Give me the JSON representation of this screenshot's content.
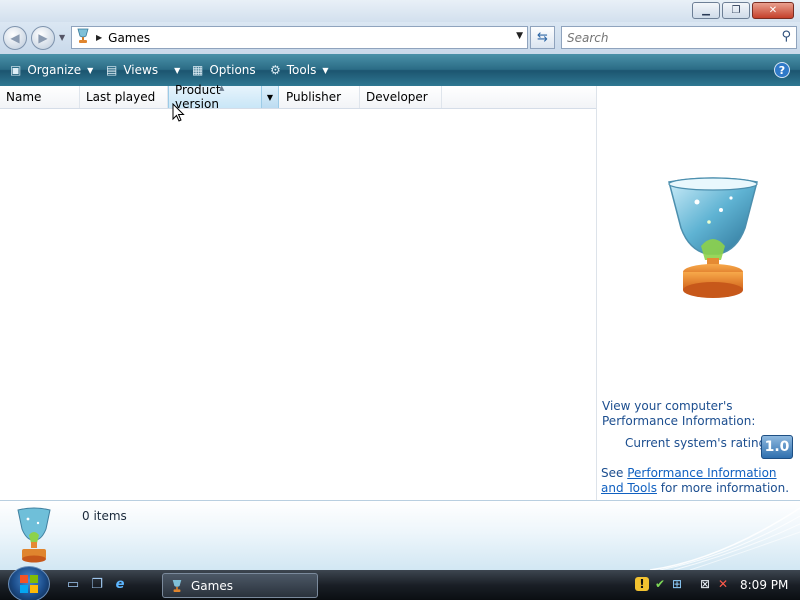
{
  "window": {
    "min_glyph": "▁",
    "max_glyph": "❐",
    "close_glyph": "✕"
  },
  "nav": {
    "back_glyph": "◀",
    "forward_glyph": "▶",
    "history_glyph": "▼"
  },
  "address": {
    "icon": "trophy-icon",
    "separator": "▶",
    "location": "Games",
    "dropdown_glyph": "▼",
    "refresh_glyph": "⇆"
  },
  "search": {
    "placeholder": "Search",
    "icon_glyph": "⚲"
  },
  "toolbar": {
    "organize": {
      "label": "Organize",
      "icon_glyph": "▣"
    },
    "views": {
      "label": "Views",
      "icon_glyph": "▤"
    },
    "options": {
      "label": "Options",
      "icon_glyph": "▦"
    },
    "tools": {
      "label": "Tools",
      "icon_glyph": "⚙"
    },
    "menu_arrow": "▼",
    "help_glyph": "?"
  },
  "columns": {
    "name": "Name",
    "last_played": "Last played",
    "product_version": "Product version",
    "publisher": "Publisher",
    "developer": "Developer",
    "dropdown_glyph": "▼",
    "sort_glyph": "▲"
  },
  "perf": {
    "title": "View your computer's Performance Information:",
    "rating_label": "Current system's rating:",
    "rating_value": "1.0",
    "see": "See",
    "link": "Performance Information and Tools",
    "suffix": "for more information."
  },
  "details": {
    "count": "0 items"
  },
  "taskbar": {
    "quicklaunch": {
      "desktop_glyph": "▭",
      "switch_glyph": "❐",
      "ie_glyph": "e"
    },
    "task_label": "Games",
    "tray": {
      "shield_glyph": "!",
      "security_glyph": "✔",
      "windows_glyph": "⊞",
      "network_glyph": "⊠",
      "volume_glyph": "✕"
    },
    "clock": "8:09 PM"
  },
  "colors": {
    "toolbar": "#2b6c86",
    "link": "#1060c0",
    "text_blue": "#1c4e8f",
    "rating_badge": "#2f6fae"
  }
}
